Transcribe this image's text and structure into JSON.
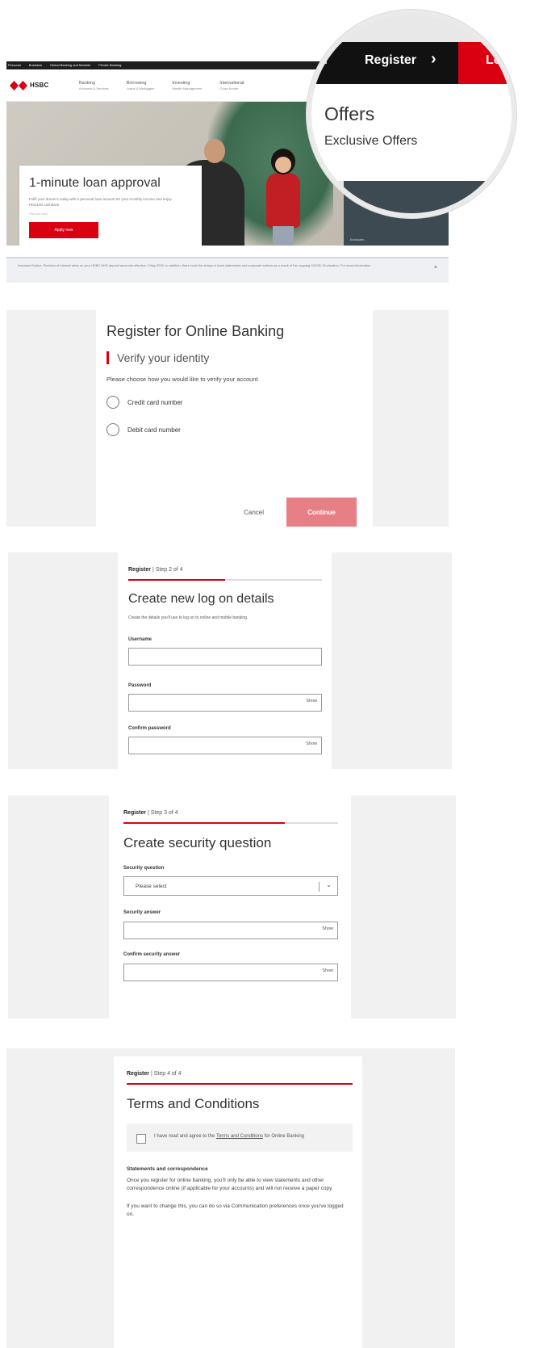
{
  "panel1": {
    "topbar": [
      "Personal",
      "Business",
      "Global Banking and Markets",
      "Private Banking"
    ],
    "logo_text": "HSBC",
    "nav": [
      {
        "title": "Banking",
        "sub": "Accounts & Services"
      },
      {
        "title": "Borrowing",
        "sub": "Loans & Mortgages"
      },
      {
        "title": "Investing",
        "sub": "Wealth Management"
      },
      {
        "title": "International",
        "sub": "Cross-border"
      }
    ],
    "loan_title": "1-minute loan approval",
    "loan_desc": "Fulfil your dream's today with a personal loan amount 8X your monthly income and enjoy HKD100 cashback",
    "loan_small": "Find out more",
    "apply_label": "Apply now",
    "dark_block_text": "Exclusive...",
    "notice_text": "Important Notice: Revision of interest rates on your HSBC HKD deposit accounts effective 1 May 2020. In addition, there could be delays in bank statements and corporate actions as a result of the ongoing COVID-19 situation. For more information",
    "notice_close": "×",
    "magnifier": {
      "search_fragment": "h",
      "register": "Register",
      "chevron": "›",
      "login_fragment": "Log",
      "offers": "Offers",
      "exclusive": "Exclusive Offers"
    }
  },
  "panel2": {
    "title": "Register for Online Banking",
    "subtitle": "Verify your identity",
    "desc": "Please choose how you would like to verify your account",
    "options": [
      "Credit card number",
      "Debit card number"
    ],
    "cancel": "Cancel",
    "continue": "Continue"
  },
  "panel3": {
    "step_register": "Register",
    "step_text": "| Step 2 of 4",
    "progress": 0.5,
    "title": "Create new log on details",
    "desc": "Create the details you'll use to log on to online and mobile banking.",
    "username_label": "Username",
    "password_label": "Password",
    "confirm_label": "Confirm password",
    "show": "Show"
  },
  "panel4": {
    "step_register": "Register",
    "step_text": "| Step 3 of 4",
    "progress": 0.75,
    "title": "Create security question",
    "question_label": "Security question",
    "select_placeholder": "Please select",
    "chevron": "⌄",
    "answer_label": "Security answer",
    "confirm_label": "Confirm security answer",
    "show": "Show"
  },
  "panel5": {
    "step_register": "Register",
    "step_text": "| Step 4 of 4",
    "title": "Terms and Conditions",
    "terms_pre": "I have read and agree to the ",
    "terms_link": "Terms and Conditions",
    "terms_post": " for Online Banking",
    "stmt_title": "Statements and correspondence",
    "stmt_p1": "Once you register for online banking, you'll only be able to view statements and other correspondence online (if applicable for your accounts) and will not receive a paper copy.",
    "stmt_p2": "If you want to change this, you can do so via Communication preferences once you've logged on."
  },
  "colors": {
    "brand_red": "#db0011",
    "disabled_red": "#e68085",
    "dark": "#111111"
  }
}
